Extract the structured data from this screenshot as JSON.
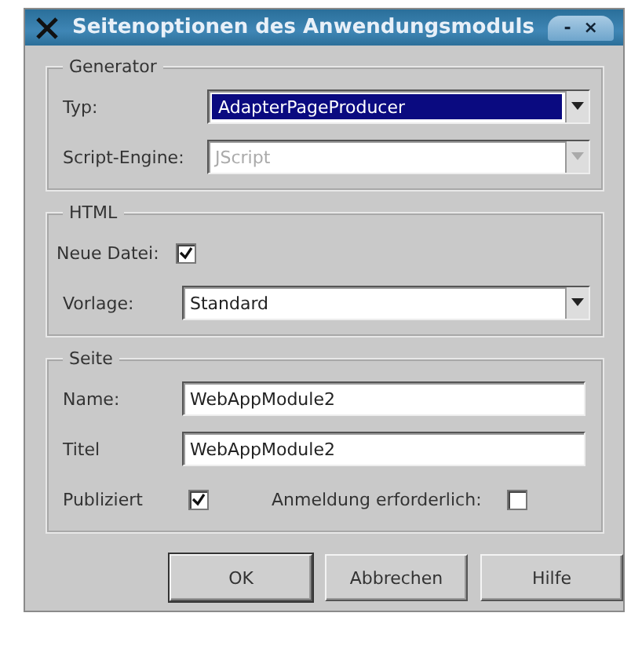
{
  "window": {
    "title": "Seitenoptionen des Anwendungsmoduls",
    "controls": [
      "-",
      "×"
    ]
  },
  "groups": [
    {
      "title": "Generator",
      "rows": [
        {
          "kind": "combo",
          "label": "Typ:",
          "value": "AdapterPageProducer",
          "selected": true,
          "disabled": false
        },
        {
          "kind": "combo",
          "label": "Script-Engine:",
          "value": "JScript",
          "selected": false,
          "disabled": true
        }
      ]
    },
    {
      "title": "HTML",
      "rows": [
        {
          "kind": "check",
          "label": "Neue Datei:",
          "checked": true
        },
        {
          "kind": "combo",
          "label": "Vorlage:",
          "value": "Standard",
          "selected": false,
          "disabled": false
        }
      ]
    },
    {
      "title": "Seite",
      "rows": [
        {
          "kind": "field",
          "label": "Name:",
          "value": "WebAppModule2"
        },
        {
          "kind": "field",
          "label": "Titel",
          "value": "WebAppModule2"
        },
        {
          "kind": "checks",
          "items": [
            {
              "label": "Publiziert",
              "checked": true
            },
            {
              "label": "Anmeldung erforderlich:",
              "checked": false
            }
          ]
        }
      ]
    }
  ],
  "buttons": [
    "OK",
    "Abbrechen",
    "Hilfe"
  ]
}
